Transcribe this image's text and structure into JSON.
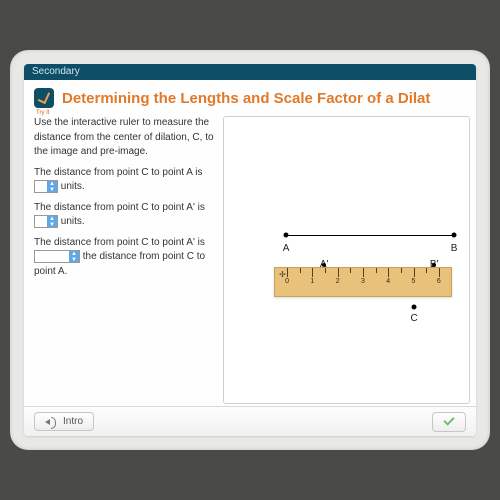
{
  "topbar": {
    "label": "Secondary"
  },
  "header": {
    "tryit_label": "Try It",
    "title": "Determining the Lengths and Scale Factor of a Dilat"
  },
  "instructions": {
    "intro": "Use the interactive ruler to measure the distance from the center of dilation, C, to the image and pre-image.",
    "line1_a": "The distance from point C to point A is",
    "line1_b": "units.",
    "line2_a": "The distance from point C to point A' is",
    "line2_b": "units.",
    "line3_a": "The distance from point C to point A' is",
    "line3_b": "the distance from point C to point A."
  },
  "canvas": {
    "labels": {
      "A": "A",
      "B": "B",
      "Ap": "A'",
      "Bp": "B'",
      "C": "C"
    },
    "ruler": {
      "center_glyph": "✢",
      "ticks": [
        1,
        2,
        3,
        4,
        5,
        6
      ]
    }
  },
  "footer": {
    "intro_label": "Intro"
  }
}
